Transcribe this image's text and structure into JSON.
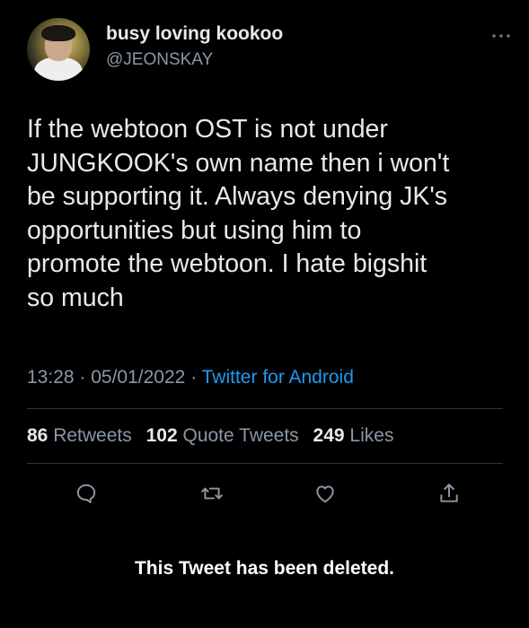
{
  "user": {
    "display_name": "busy loving kookoo",
    "handle": "@JEONSKAY"
  },
  "more_icon": "more-horizontal-icon",
  "tweet": {
    "text_lines": [
      "If the webtoon OST is not under",
      "JUNGKOOK's own name then i won't",
      "be supporting it. Always denying JK's",
      "opportunities but using him to",
      "promote the webtoon. I hate bigshit",
      "so much"
    ],
    "time": "13:28",
    "date": "05/01/2022",
    "source": "Twitter for Android"
  },
  "stats": {
    "retweets_count": "86",
    "retweets_label": "Retweets",
    "quotes_count": "102",
    "quotes_label": "Quote Tweets",
    "likes_count": "249",
    "likes_label": "Likes"
  },
  "actions": {
    "reply_icon": "reply-icon",
    "retweet_icon": "retweet-icon",
    "like_icon": "like-icon",
    "share_icon": "share-icon"
  },
  "notice": "This Tweet has been deleted.",
  "colors": {
    "background": "#000000",
    "text": "#e7e9ea",
    "secondary": "#8b98a5",
    "link": "#1d9bf0",
    "divider": "#2f3336"
  }
}
